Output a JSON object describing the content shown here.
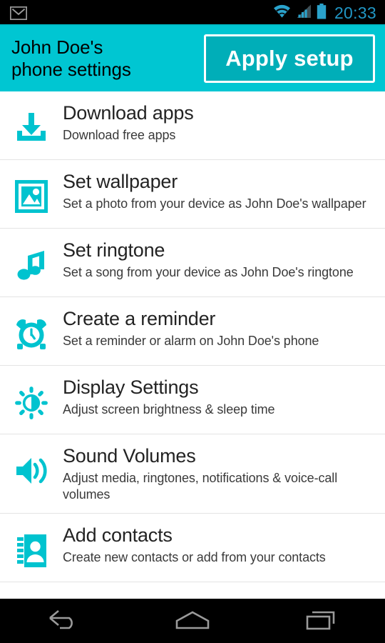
{
  "status_bar": {
    "notification_icon": "gmail-icon",
    "wifi_icon": "wifi-icon",
    "signal_icon": "cellular-signal-icon",
    "battery_icon": "battery-icon",
    "time": "20:33",
    "time_color": "#2196c4"
  },
  "header": {
    "title": "John Doe's\nphone settings",
    "apply_label": "Apply setup",
    "background_color": "#00c6d2",
    "button_color": "#00aeb8"
  },
  "accent_color": "#00c3cf",
  "settings_list": [
    {
      "icon": "download-icon",
      "title": "Download apps",
      "subtitle": "Download free apps"
    },
    {
      "icon": "image-icon",
      "title": "Set wallpaper",
      "subtitle": "Set a photo from your device as John Doe's wallpaper"
    },
    {
      "icon": "music-note-icon",
      "title": "Set ringtone",
      "subtitle": "Set a song from your device as John Doe's ringtone"
    },
    {
      "icon": "alarm-clock-icon",
      "title": "Create a reminder",
      "subtitle": "Set a reminder or alarm on John Doe's phone"
    },
    {
      "icon": "brightness-icon",
      "title": "Display Settings",
      "subtitle": "Adjust screen brightness & sleep time"
    },
    {
      "icon": "speaker-volume-icon",
      "title": "Sound Volumes",
      "subtitle": "Adjust media, ringtones, notifications & voice-call volumes"
    },
    {
      "icon": "contacts-book-icon",
      "title": "Add contacts",
      "subtitle": "Create new contacts or add from your contacts"
    }
  ],
  "navigation_bar": {
    "back": "back-icon",
    "home": "home-icon",
    "recents": "recent-apps-icon"
  }
}
